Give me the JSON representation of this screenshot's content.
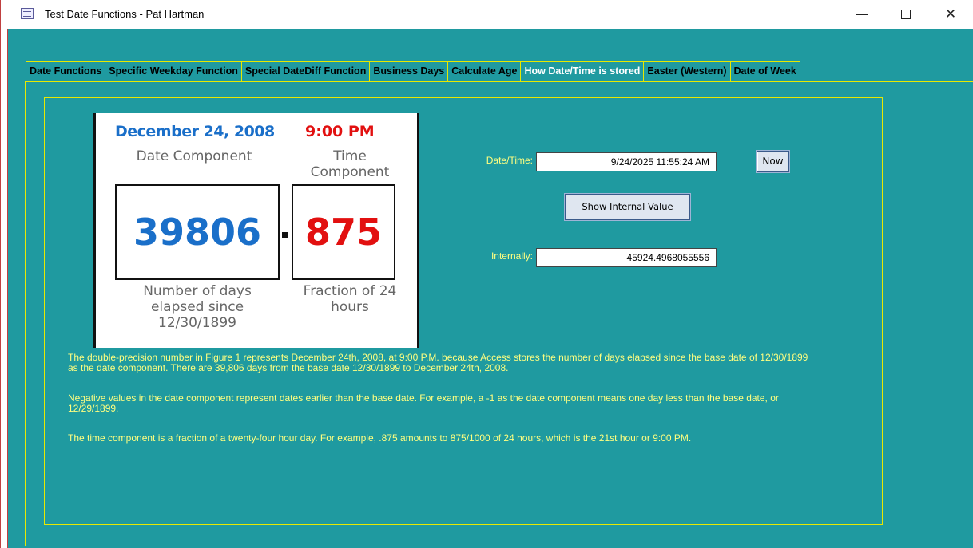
{
  "window": {
    "title": "Test Date Functions - Pat Hartman",
    "min_glyph": "—",
    "close_glyph": "✕"
  },
  "tabs": [
    {
      "label": "Date Functions",
      "active": false
    },
    {
      "label": "Specific Weekday Function",
      "active": false
    },
    {
      "label": "Special DateDiff Function",
      "active": false
    },
    {
      "label": "Business Days",
      "active": false
    },
    {
      "label": "Calculate Age",
      "active": false
    },
    {
      "label": "How Date/Time is stored",
      "active": true
    },
    {
      "label": "Easter (Western)",
      "active": false
    },
    {
      "label": "Date of Week",
      "active": false
    }
  ],
  "figure": {
    "date_title": "December 24, 2008",
    "time_title": "9:00 PM",
    "date_label": "Date Component",
    "time_label": "Time Component",
    "date_value": "39806",
    "time_value": "875",
    "date_desc": "Number of days elapsed since 12/30/1899",
    "time_desc": "Fraction of 24 hours",
    "colors": {
      "date": "#1a6fc9",
      "time": "#e21010"
    }
  },
  "controls": {
    "datetime_label": "Date/Time:",
    "datetime_value": "9/24/2025 11:55:24 AM",
    "now_label": "Now",
    "show_label": "Show Internal Value",
    "internal_label": "Internally:",
    "internal_value": "45924.4968055556"
  },
  "text": {
    "para1": "The double-precision number in Figure 1 represents December 24th, 2008, at 9:00 P.M. because Access stores the number of days elapsed since the base date of 12/30/1899 as the date component. There are 39,806 days from the base date 12/30/1899 to December 24th, 2008.",
    "para2": "Negative values in the date component represent dates earlier than the base date. For example, a -1 as the date component means one day less than the base date, or 12/29/1899.",
    "para3": "The time component is a fraction of a twenty-four hour day. For example, .875 amounts to 875/1000 of 24 hours, which is the 21st hour or 9:00 PM."
  },
  "theme": {
    "form_bg": "#1f9aa0",
    "border": "#e8e800",
    "label_color": "#ffff80"
  }
}
